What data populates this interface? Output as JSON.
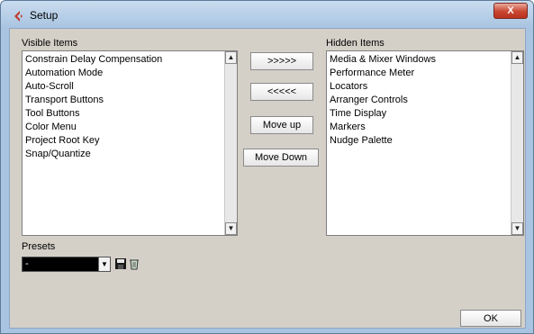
{
  "window": {
    "title": "Setup",
    "close_label": "X"
  },
  "visible_items": {
    "label": "Visible Items",
    "items": [
      "Constrain Delay Compensation",
      "Automation Mode",
      "Auto-Scroll",
      "Transport Buttons",
      "Tool Buttons",
      "Color Menu",
      "Project Root Key",
      "Snap/Quantize"
    ]
  },
  "hidden_items": {
    "label": "Hidden Items",
    "items": [
      "Media & Mixer Windows",
      "Performance Meter",
      "Locators",
      "Arranger Controls",
      "Time Display",
      "Markers",
      "Nudge Palette"
    ]
  },
  "buttons": {
    "move_right": ">>>>>",
    "move_left": "<<<<<",
    "move_up": "Move up",
    "move_down": "Move Down",
    "ok": "OK"
  },
  "presets": {
    "label": "Presets",
    "selected": "-"
  },
  "icons": {
    "app": "cubase-logo-icon",
    "save": "save-icon",
    "delete": "trash-icon"
  },
  "colors": {
    "titlebar": "#a9c4e1",
    "dialog_bg": "#d4d0c8",
    "close_button": "#c9462f",
    "app_icon": "#c0392b"
  }
}
